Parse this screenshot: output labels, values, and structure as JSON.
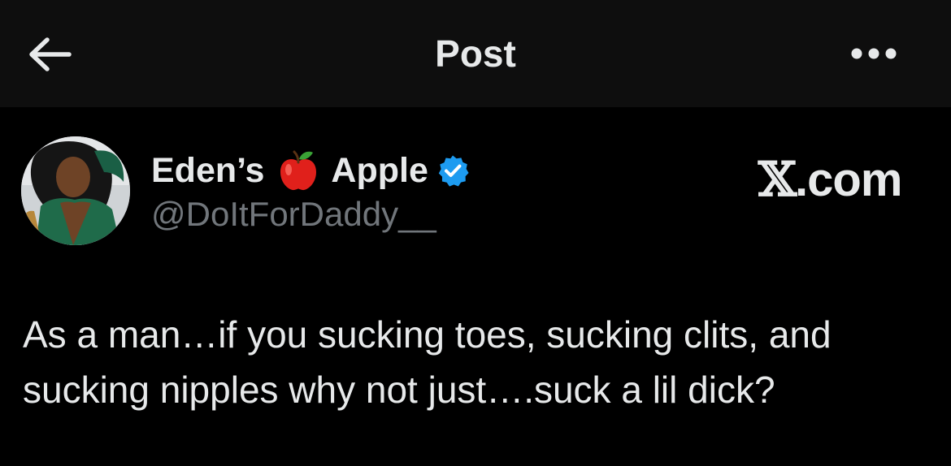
{
  "header": {
    "title": "Post",
    "back_icon": "arrow-left-icon",
    "more_icon": "more-horizontal-icon"
  },
  "author": {
    "name_part1": "Eden’s",
    "name_emoji": "red-apple-emoji",
    "name_part2": "Apple",
    "verified_icon": "verified-badge-icon",
    "verified_color": "#1d9bf0",
    "handle": "@DoItForDaddy__"
  },
  "watermark": {
    "x_glyph": "𝕏",
    "suffix": ".com"
  },
  "post": {
    "text": "As a man…if you sucking toes, sucking clits, and sucking nipples why not just….suck a lil dick?"
  },
  "colors": {
    "background": "#000000",
    "header_background": "#0e0e0e",
    "text_primary": "#e7e9ea",
    "text_secondary": "#71767b"
  }
}
